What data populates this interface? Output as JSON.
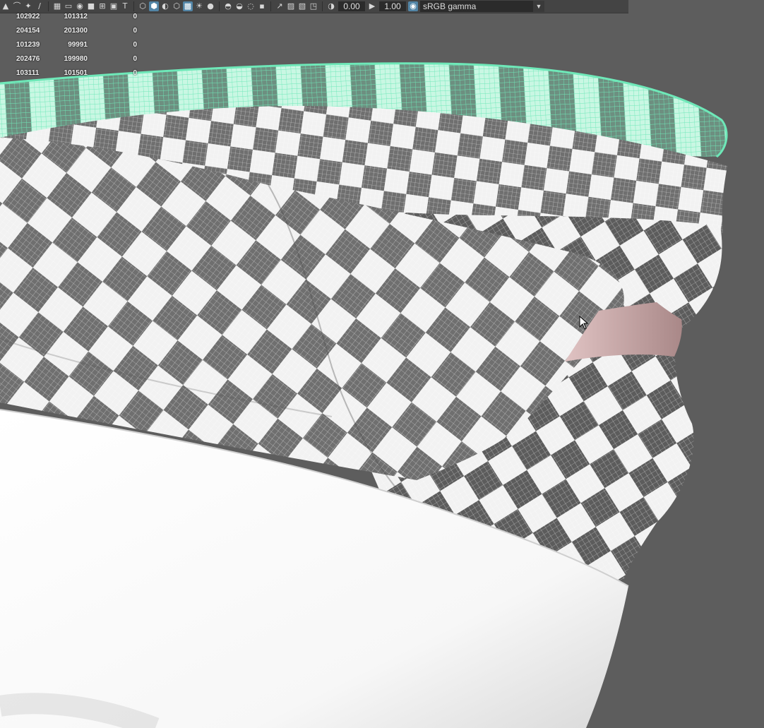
{
  "toolbar": {
    "icons": [
      "select-icon",
      "lasso-icon",
      "paint-icon",
      "brush-icon",
      "grid-icon",
      "film-gate-icon",
      "resolution-gate-icon",
      "gate-mask-icon",
      "field-chart-icon",
      "safe-action-icon",
      "text-icon",
      "wireframe-icon",
      "smooth-shade-icon",
      "default-material-icon",
      "wireframe-on-shaded-icon",
      "textured-icon",
      "lights-icon",
      "shadows-icon",
      "ambient-occlusion-icon",
      "motion-blur-icon",
      "anti-aliasing-icon",
      "depth-of-field-icon",
      "isolate-icon",
      "xray-icon",
      "xray-joints-icon",
      "xray-components-icon",
      "exposure-icon",
      "gamma-icon",
      "color-management-icon"
    ],
    "exposure_value": "0.00",
    "gamma_value": "1.00",
    "color_space": "sRGB gamma"
  },
  "hud": {
    "rows": [
      [
        "102922",
        "101312",
        "0"
      ],
      [
        "204154",
        "201300",
        "0"
      ],
      [
        "101239",
        "99991",
        "0"
      ],
      [
        "202476",
        "199980",
        "0"
      ],
      [
        "103111",
        "101501",
        "0"
      ]
    ]
  },
  "viewport": {
    "background": "#5d5d5d",
    "selected_color": "#6ee8b8",
    "checker_dark": "#6f6f6f",
    "checker_light": "#f2f2f2",
    "pin_color": "#c9a8a8"
  }
}
